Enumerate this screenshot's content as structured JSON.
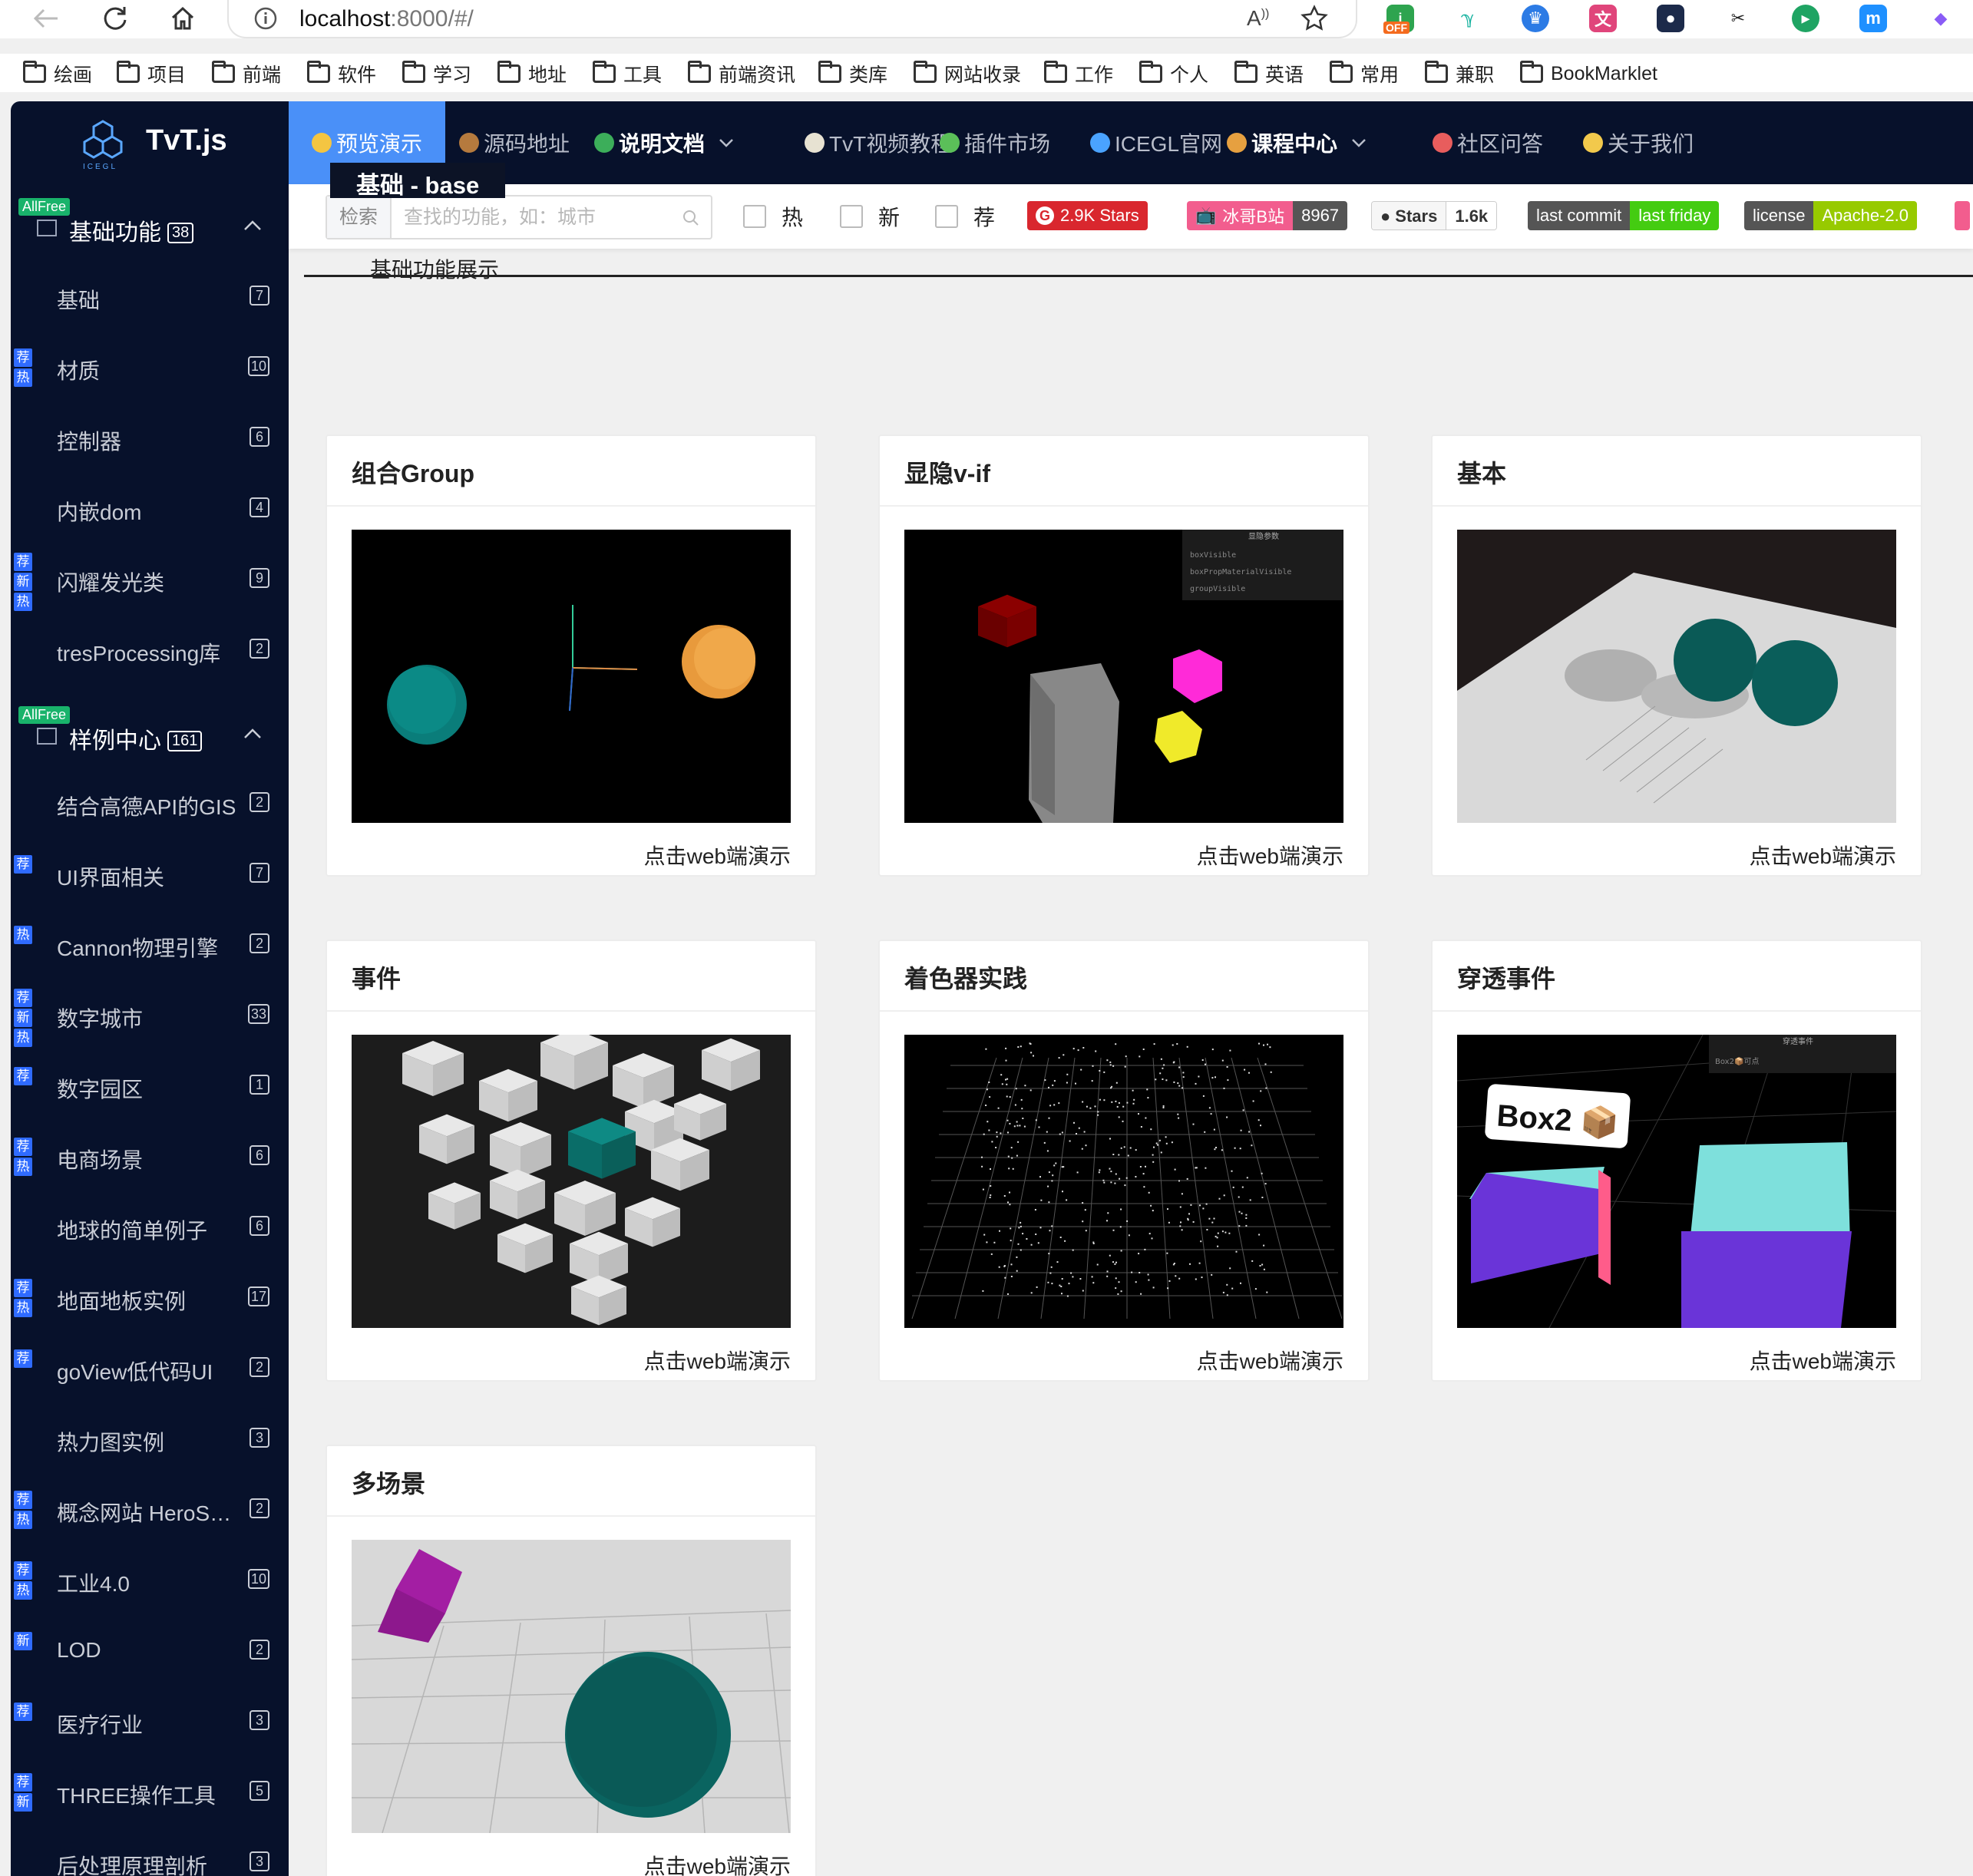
{
  "browser": {
    "url_host": "localhost",
    "url_rest": ":8000/#/",
    "extension_badge": "OFF",
    "bookmarks": [
      "绘画",
      "项目",
      "前端",
      "软件",
      "学习",
      "地址",
      "工具",
      "前端资讯",
      "类库",
      "网站收录",
      "工作",
      "个人",
      "英语",
      "常用",
      "兼职",
      "BookMarklet"
    ]
  },
  "app": {
    "logo_text": "TvT.js",
    "logo_subtext": "ICEGL",
    "nav": [
      {
        "label": "预览演示",
        "active": true
      },
      {
        "label": "源码地址"
      },
      {
        "label": "说明文档",
        "caret": true
      },
      {
        "label": "TvT视频教程"
      },
      {
        "label": "插件市场"
      },
      {
        "label": "ICEGL官网"
      },
      {
        "label": "课程中心",
        "caret": true
      },
      {
        "label": "社区问答"
      },
      {
        "label": "关于我们"
      }
    ]
  },
  "sidebar": {
    "groups": [
      {
        "title": "基础功能",
        "count": "38",
        "tag": "AllFree"
      },
      {
        "title": "样例中心",
        "count": "161",
        "tag": "AllFree"
      }
    ],
    "items": [
      {
        "label": "基础",
        "count": "7",
        "badges": []
      },
      {
        "label": "材质",
        "count": "10",
        "badges": [
          "荐",
          "热"
        ]
      },
      {
        "label": "控制器",
        "count": "6",
        "badges": []
      },
      {
        "label": "内嵌dom",
        "count": "4",
        "badges": []
      },
      {
        "label": "闪耀发光类",
        "count": "9",
        "badges": [
          "荐",
          "新",
          "热"
        ]
      },
      {
        "label": "tresProcessing库",
        "count": "2",
        "badges": []
      },
      {
        "label": "结合高德API的GIS",
        "count": "2",
        "badges": []
      },
      {
        "label": "UI界面相关",
        "count": "7",
        "badges": [
          "荐"
        ]
      },
      {
        "label": "Cannon物理引擎",
        "count": "2",
        "badges": [
          "热"
        ]
      },
      {
        "label": "数字城市",
        "count": "33",
        "badges": [
          "荐",
          "新",
          "热"
        ]
      },
      {
        "label": "数字园区",
        "count": "1",
        "badges": [
          "荐"
        ]
      },
      {
        "label": "电商场景",
        "count": "6",
        "badges": [
          "荐",
          "热"
        ]
      },
      {
        "label": "地球的简单例子",
        "count": "6",
        "badges": []
      },
      {
        "label": "地面地板实例",
        "count": "17",
        "badges": [
          "荐",
          "热"
        ]
      },
      {
        "label": "goView低代码UI",
        "count": "2",
        "badges": [
          "荐"
        ]
      },
      {
        "label": "热力图实例",
        "count": "3",
        "badges": []
      },
      {
        "label": "概念网站 HeroSecti...",
        "count": "2",
        "badges": [
          "荐",
          "热"
        ]
      },
      {
        "label": "工业4.0",
        "count": "10",
        "badges": [
          "荐",
          "热"
        ]
      },
      {
        "label": "LOD",
        "count": "2",
        "badges": [
          "新"
        ]
      },
      {
        "label": "医疗行业",
        "count": "3",
        "badges": [
          "荐"
        ]
      },
      {
        "label": "THREE操作工具",
        "count": "5",
        "badges": [
          "荐",
          "新"
        ]
      },
      {
        "label": "后处理原理剖析",
        "count": "3",
        "badges": []
      }
    ]
  },
  "filters": {
    "search_prefix": "检索",
    "search_placeholder": "查找的功能，如：城市",
    "checkboxes": [
      "热",
      "新",
      "荐"
    ],
    "shields": [
      {
        "left": "2.9K Stars",
        "right": ""
      },
      {
        "left": "冰哥B站",
        "right": "8967"
      },
      {
        "left": "Stars",
        "right": "1.6k"
      },
      {
        "left": "last commit",
        "right": "last friday"
      },
      {
        "left": "license",
        "right": "Apache-2.0"
      }
    ]
  },
  "content": {
    "section_title": "基础 - base",
    "section_desc": "基础功能展示",
    "cards": [
      {
        "title": "组合Group",
        "link": "点击web端演示"
      },
      {
        "title": "显隐v-if",
        "link": "点击web端演示"
      },
      {
        "title": "基本",
        "link": "点击web端演示"
      },
      {
        "title": "事件",
        "link": "点击web端演示"
      },
      {
        "title": "着色器实践",
        "link": "点击web端演示"
      },
      {
        "title": "穿透事件",
        "link": "点击web端演示"
      },
      {
        "title": "多场景",
        "link": "点击web端演示"
      }
    ],
    "preview_texts": {
      "gui_title": "显隐参数",
      "gui_rows": [
        "boxVisible",
        "boxPropMaterialVisible",
        "groupVisible"
      ],
      "pierce_gui_title": "穿透事件",
      "pierce_gui_row": "Box2📦可点",
      "pierce_label": "Box2 📦"
    }
  }
}
